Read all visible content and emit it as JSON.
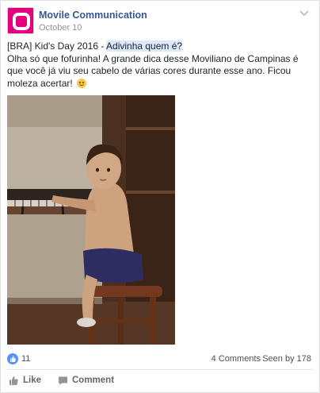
{
  "post": {
    "page_name": "Movile Communication",
    "date": "October 10",
    "text_prefix": "[BRA] Kid's Day 2016 - ",
    "text_highlight": "Adivinha quem é?",
    "text_body": "Olha só que fofurinha! A grande dica desse Moviliano de Campinas é que você já viu seu cabelo de várias cores durante esse ano. Ficou moleza acertar!",
    "emoji": "slightly-smiling-face"
  },
  "stats": {
    "likes": "11",
    "comments": "4 Comments",
    "seen_by": "Seen by 178"
  },
  "actions": {
    "like_label": "Like",
    "comment_label": "Comment"
  },
  "colors": {
    "brand": "#e5007d",
    "link": "#365899",
    "like_blue": "#5890ff"
  }
}
